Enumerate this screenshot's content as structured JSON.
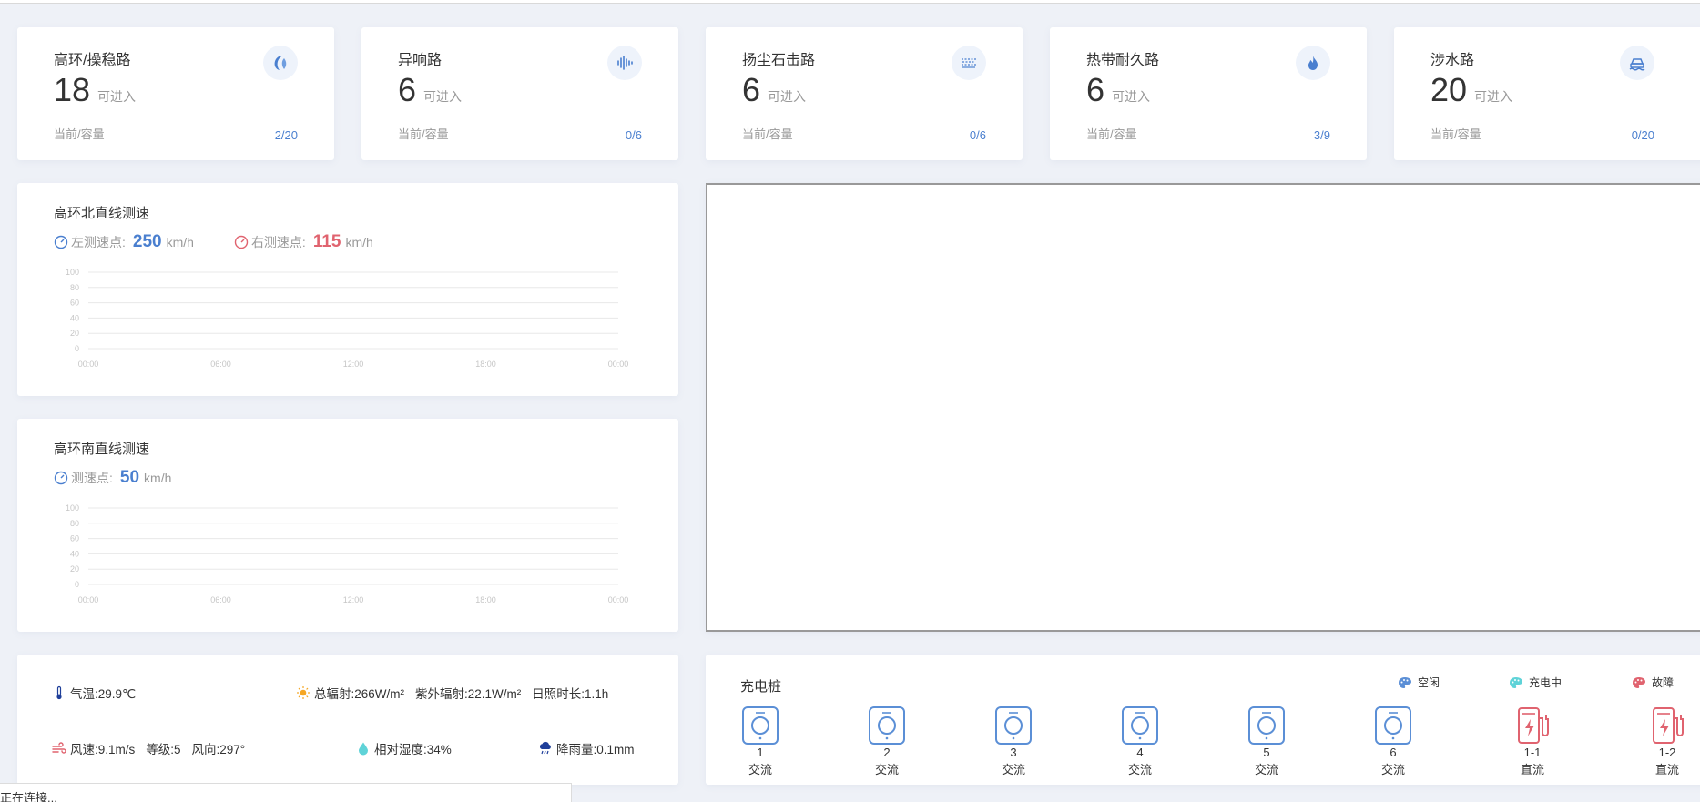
{
  "stats": [
    {
      "title": "高环/操稳路",
      "count": "18",
      "unit": "可进入",
      "cap_label": "当前/容量",
      "cap_value": "2/20",
      "icon": "moon-sail-icon"
    },
    {
      "title": "异响路",
      "count": "6",
      "unit": "可进入",
      "cap_label": "当前/容量",
      "cap_value": "0/6",
      "icon": "soundwave-icon"
    },
    {
      "title": "扬尘石击路",
      "count": "6",
      "unit": "可进入",
      "cap_label": "当前/容量",
      "cap_value": "0/6",
      "icon": "dust-icon"
    },
    {
      "title": "热带耐久路",
      "count": "6",
      "unit": "可进入",
      "cap_label": "当前/容量",
      "cap_value": "3/9",
      "icon": "flame-icon"
    },
    {
      "title": "涉水路",
      "count": "20",
      "unit": "可进入",
      "cap_label": "当前/容量",
      "cap_value": "0/20",
      "icon": "car-water-icon"
    }
  ],
  "north": {
    "title": "高环北直线测速",
    "left_label": "左测速点:",
    "left_value": "250",
    "right_label": "右测速点:",
    "right_value": "115",
    "unit": "km/h"
  },
  "south": {
    "title": "高环南直线测速",
    "label": "测速点:",
    "value": "50",
    "unit": "km/h"
  },
  "chart_data": [
    {
      "type": "line",
      "categories": [
        "00:00",
        "06:00",
        "12:00",
        "18:00",
        "00:00"
      ],
      "yticks": [
        "0",
        "20",
        "40",
        "60",
        "80",
        "100"
      ],
      "ylim": [
        0,
        100
      ],
      "series": [],
      "grid": true
    },
    {
      "type": "line",
      "categories": [
        "00:00",
        "06:00",
        "12:00",
        "18:00",
        "00:00"
      ],
      "yticks": [
        "0",
        "20",
        "40",
        "60",
        "80",
        "100"
      ],
      "ylim": [
        0,
        100
      ],
      "series": [],
      "grid": true
    }
  ],
  "weather": {
    "temperature": "气温:29.9℃",
    "radiation": "总辐射:266W/m²",
    "uv": "紫外辐射:22.1W/m²",
    "sunshine": "日照时长:1.1h",
    "wind_speed": "风速:9.1m/s",
    "wind_level": "等级:5",
    "wind_dir": "风向:297°",
    "humidity": "相对湿度:34%",
    "rain": "降雨量:0.1mm"
  },
  "charging": {
    "title": "充电桩",
    "legend": [
      {
        "label": "空闲",
        "color": "#5b8fd6"
      },
      {
        "label": "充电中",
        "color": "#5fd3d8"
      },
      {
        "label": "故障",
        "color": "#e0636f"
      }
    ],
    "piles": [
      {
        "id": "1",
        "type": "交流",
        "status": "idle"
      },
      {
        "id": "2",
        "type": "交流",
        "status": "idle"
      },
      {
        "id": "3",
        "type": "交流",
        "status": "idle"
      },
      {
        "id": "4",
        "type": "交流",
        "status": "idle"
      },
      {
        "id": "5",
        "type": "交流",
        "status": "idle"
      },
      {
        "id": "6",
        "type": "交流",
        "status": "idle"
      },
      {
        "id": "1-1",
        "type": "直流",
        "status": "fault"
      },
      {
        "id": "1-2",
        "type": "直流",
        "status": "fault"
      }
    ]
  },
  "status_tip": "正在连接..."
}
